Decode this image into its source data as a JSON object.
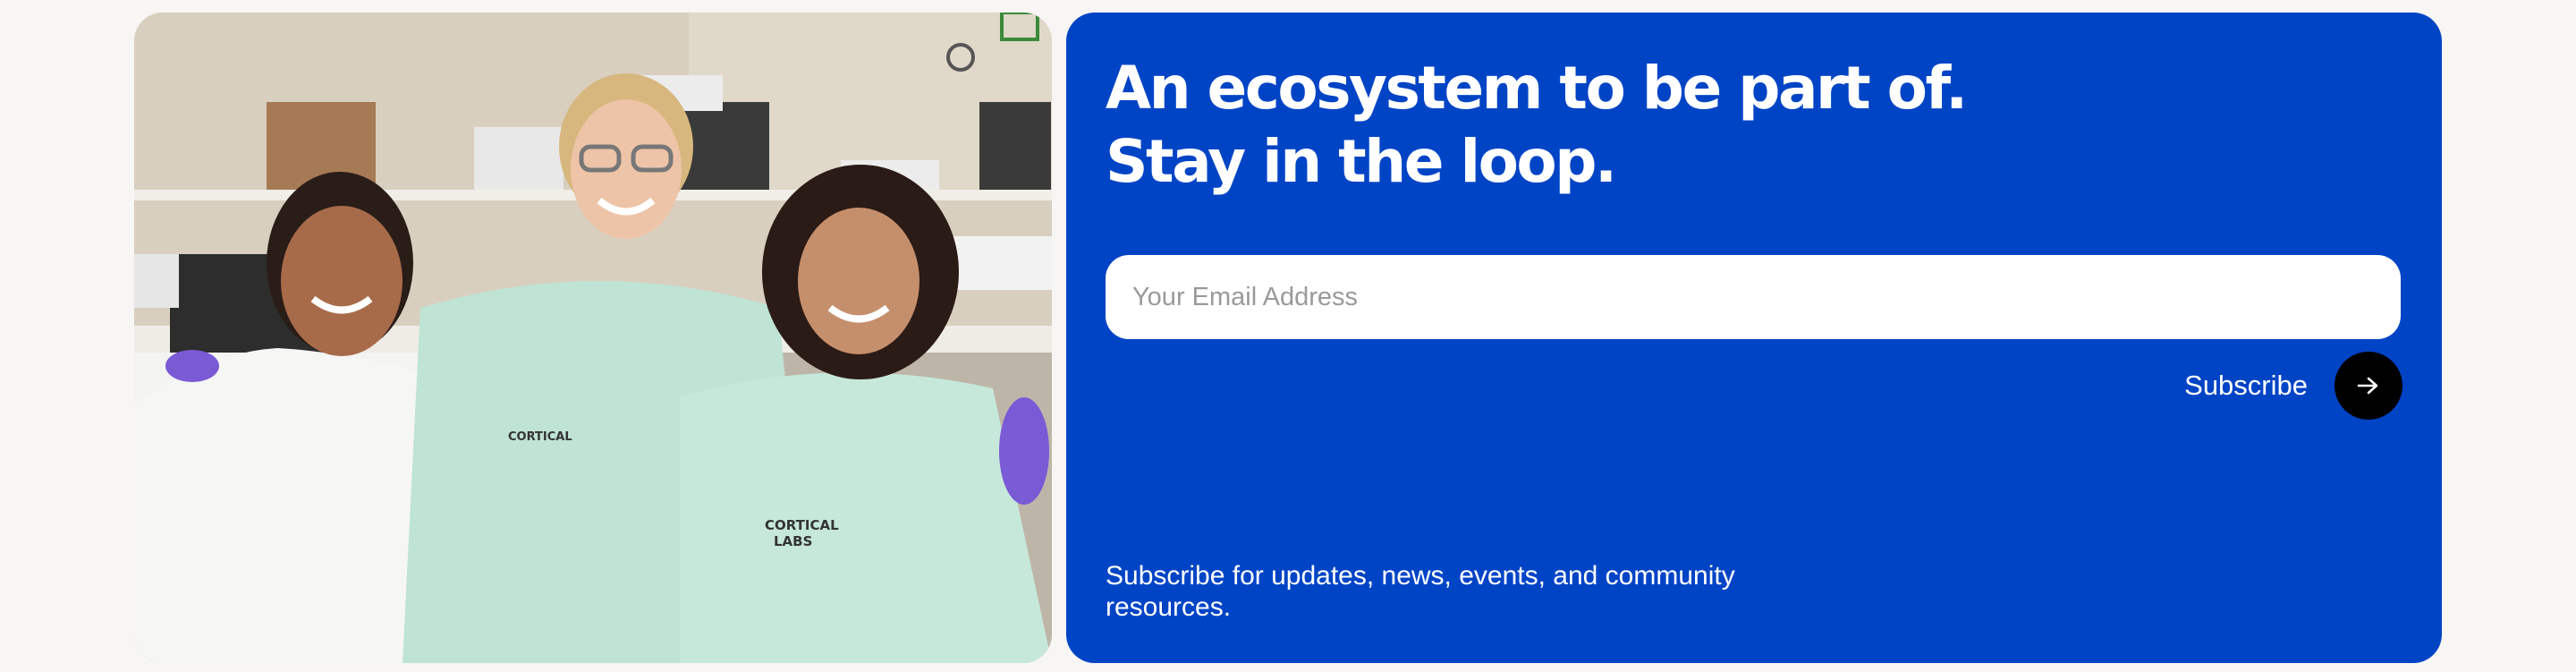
{
  "photo": {
    "alt": "Three smiling researchers in lab gowns standing together in a laboratory",
    "gown_logo_line1": "CORTICAL",
    "gown_logo_line2": "LABS"
  },
  "signup": {
    "headline_line1": "An ecosystem to be part of.",
    "headline_line2": "Stay in the loop.",
    "email_placeholder": "Your Email Address",
    "email_value": "",
    "subscribe_label": "Subscribe",
    "subscribe_icon": "arrow-right-icon",
    "footnote": "Subscribe for updates, news, events, and community resources."
  },
  "colors": {
    "page_background": "#f7f6f5",
    "card_background": "#0044c6",
    "button_background": "#000000",
    "input_background": "#ffffff"
  }
}
